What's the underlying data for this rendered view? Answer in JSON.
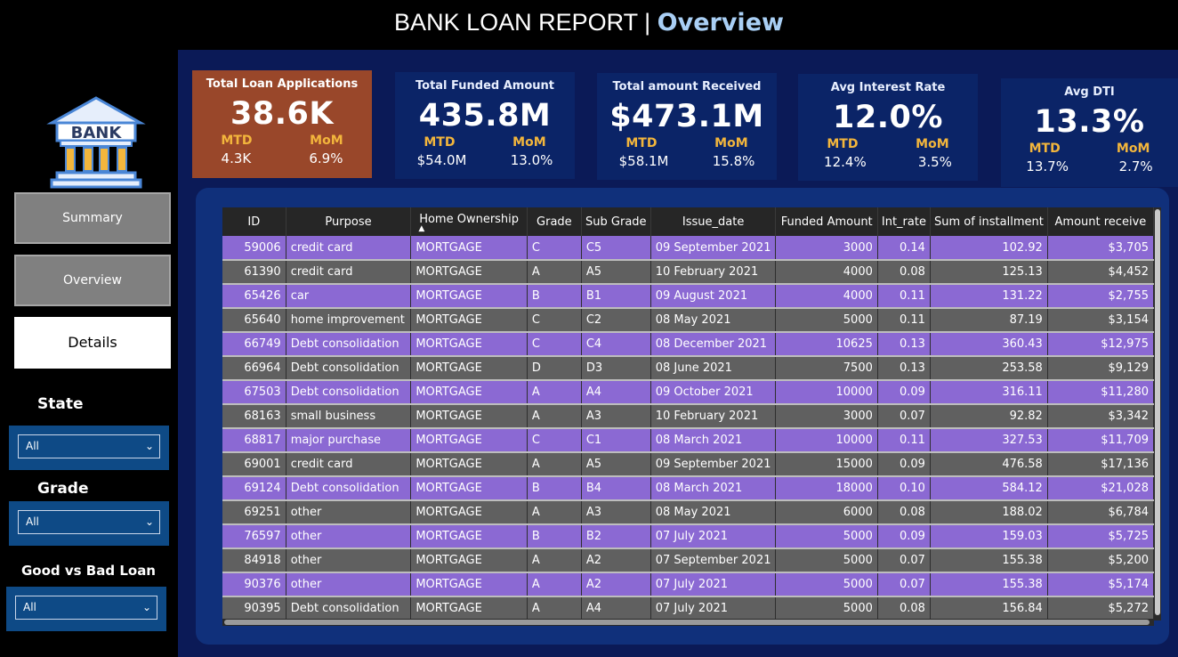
{
  "header": {
    "title": "BANK LOAN REPORT | ",
    "subtitle": "Overview"
  },
  "sidebar": {
    "logo_text": "BANK",
    "nav": [
      {
        "label": "Summary"
      },
      {
        "label": "Overview"
      },
      {
        "label": "Details"
      }
    ],
    "filters": [
      {
        "label": "State",
        "value": "All"
      },
      {
        "label": "Grade",
        "value": "All"
      },
      {
        "label": "Good vs Bad Loan",
        "value": "All"
      }
    ]
  },
  "kpis": [
    {
      "title": "Total Loan Applications",
      "value": "38.6K",
      "mtd_label": "MTD",
      "mom_label": "MoM",
      "mtd": "4.3K",
      "mom": "6.9%"
    },
    {
      "title": "Total Funded Amount",
      "value": "435.8M",
      "mtd_label": "MTD",
      "mom_label": "MoM",
      "mtd": "$54.0M",
      "mom": "13.0%"
    },
    {
      "title": "Total amount Received",
      "value": "$473.1M",
      "mtd_label": "MTD",
      "mom_label": "MoM",
      "mtd": "$58.1M",
      "mom": "15.8%"
    },
    {
      "title": "Avg Interest Rate",
      "value": "12.0%",
      "mtd_label": "MTD",
      "mom_label": "MoM",
      "mtd": "12.4%",
      "mom": "3.5%"
    },
    {
      "title": "Avg DTI",
      "value": "13.3%",
      "mtd_label": "MTD",
      "mom_label": "MoM",
      "mtd": "13.7%",
      "mom": "2.7%"
    }
  ],
  "table": {
    "columns": [
      "ID",
      "Purpose",
      "Home Ownership",
      "Grade",
      "Sub Grade",
      "Issue_date",
      "Funded Amount",
      "Int_rate",
      "Sum of installment",
      "Amount receive"
    ],
    "rows": [
      [
        "59006",
        "credit card",
        "MORTGAGE",
        "C",
        "C5",
        "09 September 2021",
        "3000",
        "0.14",
        "102.92",
        "$3,705"
      ],
      [
        "61390",
        "credit card",
        "MORTGAGE",
        "A",
        "A5",
        "10 February 2021",
        "4000",
        "0.08",
        "125.13",
        "$4,452"
      ],
      [
        "65426",
        "car",
        "MORTGAGE",
        "B",
        "B1",
        "09 August 2021",
        "4000",
        "0.11",
        "131.22",
        "$2,755"
      ],
      [
        "65640",
        "home improvement",
        "MORTGAGE",
        "C",
        "C2",
        "08 May 2021",
        "5000",
        "0.11",
        "87.19",
        "$3,154"
      ],
      [
        "66749",
        "Debt consolidation",
        "MORTGAGE",
        "C",
        "C4",
        "08 December 2021",
        "10625",
        "0.13",
        "360.43",
        "$12,975"
      ],
      [
        "66964",
        "Debt consolidation",
        "MORTGAGE",
        "D",
        "D3",
        "08 June 2021",
        "7500",
        "0.13",
        "253.58",
        "$9,129"
      ],
      [
        "67503",
        "Debt consolidation",
        "MORTGAGE",
        "A",
        "A4",
        "09 October 2021",
        "10000",
        "0.09",
        "316.11",
        "$11,280"
      ],
      [
        "68163",
        "small business",
        "MORTGAGE",
        "A",
        "A3",
        "10 February 2021",
        "3000",
        "0.07",
        "92.82",
        "$3,342"
      ],
      [
        "68817",
        "major purchase",
        "MORTGAGE",
        "C",
        "C1",
        "08 March 2021",
        "10000",
        "0.11",
        "327.53",
        "$11,709"
      ],
      [
        "69001",
        "credit card",
        "MORTGAGE",
        "A",
        "A5",
        "09 September 2021",
        "15000",
        "0.09",
        "476.58",
        "$17,136"
      ],
      [
        "69124",
        "Debt consolidation",
        "MORTGAGE",
        "B",
        "B4",
        "08 March 2021",
        "18000",
        "0.10",
        "584.12",
        "$21,028"
      ],
      [
        "69251",
        "other",
        "MORTGAGE",
        "A",
        "A3",
        "08 May 2021",
        "6000",
        "0.08",
        "188.02",
        "$6,784"
      ],
      [
        "76597",
        "other",
        "MORTGAGE",
        "B",
        "B2",
        "07 July 2021",
        "5000",
        "0.09",
        "159.03",
        "$5,725"
      ],
      [
        "84918",
        "other",
        "MORTGAGE",
        "A",
        "A2",
        "07 September 2021",
        "5000",
        "0.07",
        "155.38",
        "$5,200"
      ],
      [
        "90376",
        "other",
        "MORTGAGE",
        "A",
        "A2",
        "07 July 2021",
        "5000",
        "0.07",
        "155.38",
        "$5,174"
      ],
      [
        "90395",
        "Debt consolidation",
        "MORTGAGE",
        "A",
        "A4",
        "07 July 2021",
        "5000",
        "0.08",
        "156.84",
        "$5,272"
      ]
    ]
  },
  "colors": {
    "accent": "#a9cff5",
    "orange_card": "#99472a",
    "row_odd": "#8b69d3",
    "row_even": "#606060",
    "kpi_label": "#f3b63c"
  }
}
